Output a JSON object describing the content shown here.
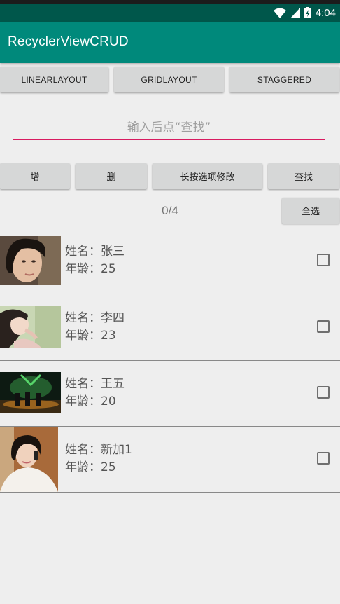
{
  "status_bar": {
    "time": "4:04",
    "icons": [
      "wifi-icon",
      "signal-icon",
      "battery-charging-icon"
    ]
  },
  "app_bar": {
    "title": "RecyclerViewCRUD"
  },
  "layout_buttons": {
    "linear": "LINEARLAYOUT",
    "grid": "GRIDLAYOUT",
    "staggered": "STAGGERED"
  },
  "search": {
    "placeholder": "输入后点“查找”",
    "value": ""
  },
  "action_buttons": {
    "add": "增",
    "delete": "删",
    "edit": "长按选项修改",
    "find": "查找"
  },
  "selection": {
    "count": "0/4",
    "select_all": "全选"
  },
  "items": [
    {
      "name": "姓名：张三",
      "age": "年龄：25",
      "checked": false,
      "avatar": "short-hair-woman-portrait"
    },
    {
      "name": "姓名：李四",
      "age": "年龄：23",
      "checked": false,
      "avatar": "painted-woman-illustration"
    },
    {
      "name": "姓名：王五",
      "age": "年龄：20",
      "checked": false,
      "avatar": "game-soldiers-scene"
    },
    {
      "name": "姓名：新加1",
      "age": "年龄：25",
      "checked": false,
      "avatar": "woman-on-phone-portrait"
    }
  ],
  "colors": {
    "status_bar": "#00574b",
    "app_bar": "#00897b",
    "accent": "#d81b60",
    "background": "#eeeeee",
    "button": "#d6d7d7"
  }
}
